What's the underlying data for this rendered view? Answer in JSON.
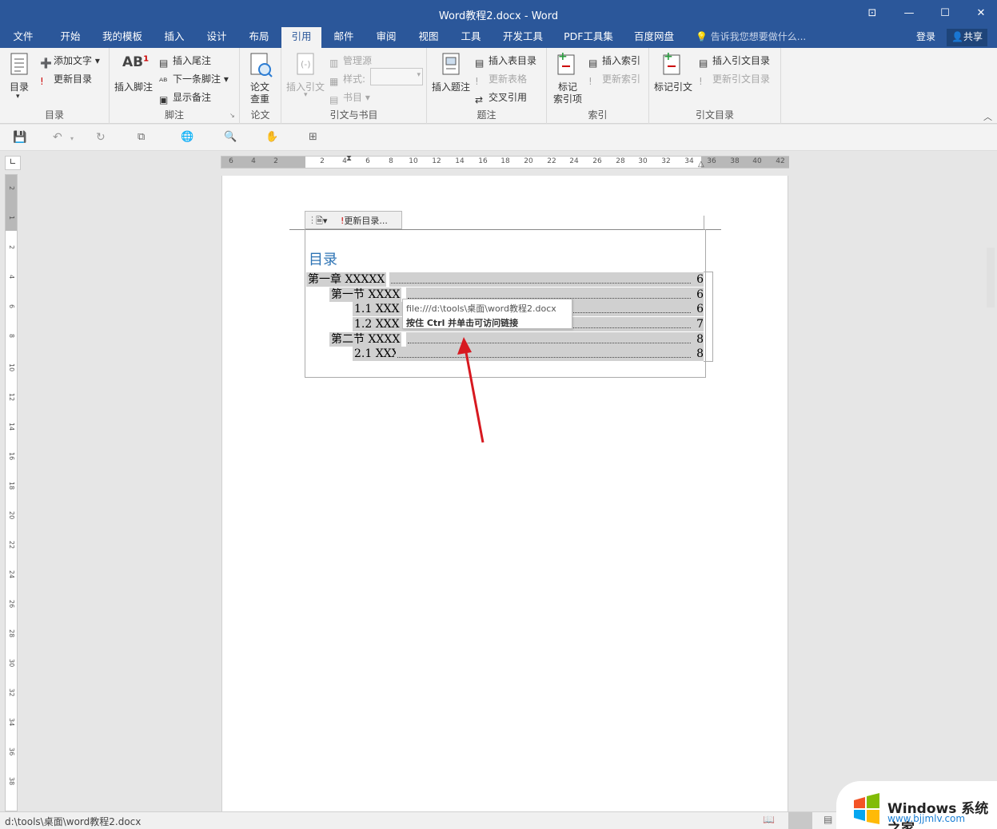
{
  "window": {
    "title": "Word教程2.docx - Word",
    "controls": [
      "restore-ribbon",
      "minimize",
      "maximize",
      "close"
    ]
  },
  "tabs": [
    {
      "label": "文件"
    },
    {
      "label": "开始"
    },
    {
      "label": "我的模板"
    },
    {
      "label": "插入"
    },
    {
      "label": "设计"
    },
    {
      "label": "布局"
    },
    {
      "label": "引用",
      "active": true
    },
    {
      "label": "邮件"
    },
    {
      "label": "审阅"
    },
    {
      "label": "视图"
    },
    {
      "label": "工具"
    },
    {
      "label": "开发工具"
    },
    {
      "label": "PDF工具集"
    },
    {
      "label": "百度网盘"
    }
  ],
  "tellme": "告诉我您想要做什么...",
  "login": "登录",
  "share": "共享",
  "ribbon": {
    "toc": {
      "label": "目录",
      "big": "目录",
      "add_text": "添加文字",
      "update": "更新目录"
    },
    "footnote": {
      "label": "脚注",
      "insert": "插入脚注",
      "endnote": "插入尾注",
      "next": "下一条脚注",
      "show": "显示备注"
    },
    "paper": {
      "label": "论文",
      "check": "论文",
      "check2": "查重"
    },
    "citation": {
      "label": "引文与书目",
      "insert": "插入引文",
      "manage": "管理源",
      "style": "样式:",
      "biblio": "书目"
    },
    "caption": {
      "label": "题注",
      "insert": "插入题注",
      "table_toc": "插入表目录",
      "update_table": "更新表格",
      "cross_ref": "交叉引用"
    },
    "index": {
      "label": "索引",
      "mark": "标记",
      "mark2": "索引项",
      "insert": "插入索引",
      "update": "更新索引"
    },
    "toa": {
      "label": "引文目录",
      "mark": "标记引文",
      "insert": "插入引文目录",
      "update": "更新引文目录"
    }
  },
  "hruler": {
    "numbers": [
      "6",
      "4",
      "2",
      "2",
      "4",
      "6",
      "8",
      "10",
      "12",
      "14",
      "16",
      "18",
      "20",
      "22",
      "24",
      "26",
      "28",
      "30",
      "32",
      "34",
      "36",
      "38",
      "40",
      "42"
    ]
  },
  "vruler": {
    "numbers": [
      "2",
      "1",
      "2",
      "4",
      "6",
      "8",
      "10",
      "12",
      "14",
      "16",
      "18",
      "20",
      "22",
      "24",
      "26",
      "28",
      "30",
      "32",
      "34",
      "36",
      "38"
    ]
  },
  "toc_control": {
    "update": "更新目录..."
  },
  "document": {
    "heading": "目录",
    "entries": [
      {
        "text": "第一章  XXXXX",
        "page": "6"
      },
      {
        "text": "第一节  XXXX",
        "page": "6"
      },
      {
        "text": "1.1 XXX",
        "page": "6"
      },
      {
        "text": "1.2 XXX",
        "page": "7"
      },
      {
        "text": "第二节  XXXX",
        "page": "8"
      },
      {
        "text": "2.1 XXX",
        "page": "8"
      }
    ]
  },
  "tooltip": {
    "link": "file:///d:\\tools\\桌面\\word教程2.docx",
    "hint": "按住 Ctrl 并单击可访问链接"
  },
  "status": {
    "path": "d:\\tools\\桌面\\word教程2.docx"
  },
  "watermark": {
    "brand": "Windows 系统之家",
    "url": "www.bjjmlv.com"
  },
  "colors": {
    "accent": "#2b579a",
    "arrow": "#d71920",
    "heading": "#2e74b5"
  }
}
